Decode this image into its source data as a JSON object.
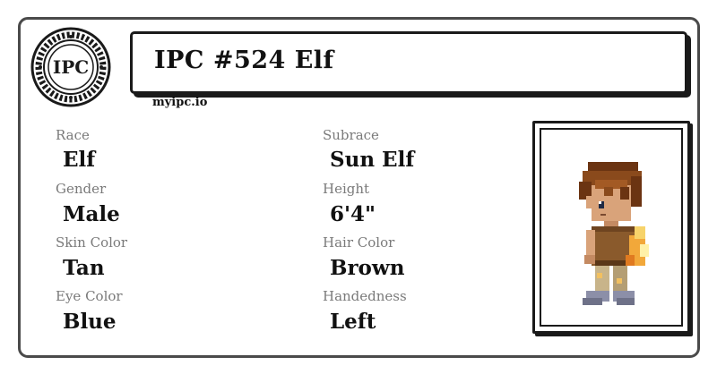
{
  "header": {
    "seal_text": "IPC",
    "title": "IPC #524 Elf",
    "site": "myipc.io"
  },
  "fields": {
    "race": {
      "label": "Race",
      "value": "Elf"
    },
    "subrace": {
      "label": "Subrace",
      "value": "Sun Elf"
    },
    "gender": {
      "label": "Gender",
      "value": "Male"
    },
    "height": {
      "label": "Height",
      "value": "6'4\""
    },
    "skin_color": {
      "label": "Skin Color",
      "value": "Tan"
    },
    "hair_color": {
      "label": "Hair Color",
      "value": "Brown"
    },
    "eye_color": {
      "label": "Eye Color",
      "value": "Blue"
    },
    "handedness": {
      "label": "Handedness",
      "value": "Left"
    }
  },
  "portrait": {
    "subject": "pixel-art elf character sprite"
  }
}
